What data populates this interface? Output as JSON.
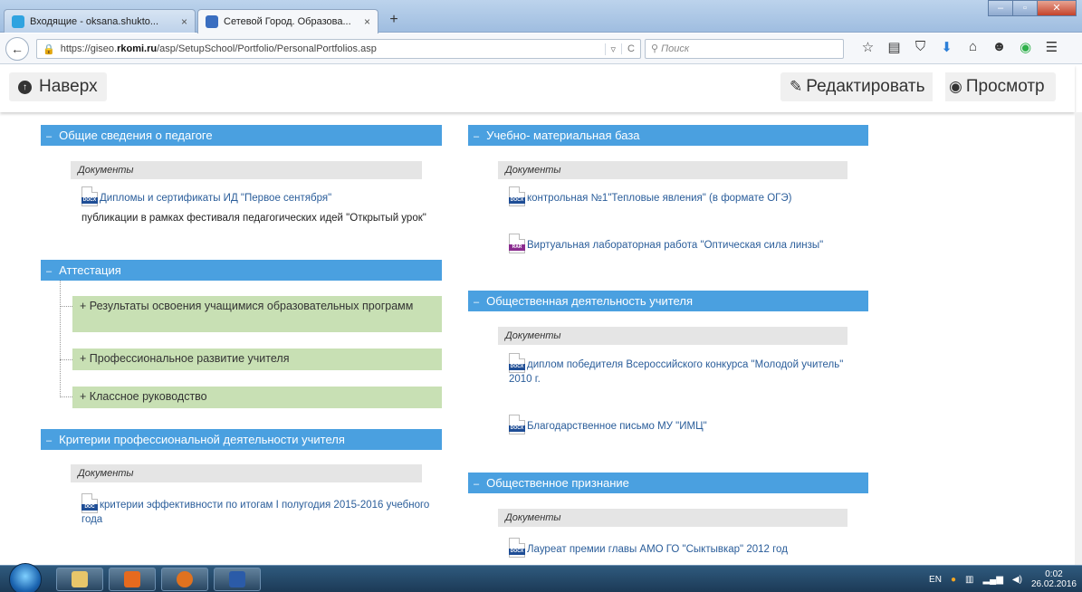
{
  "browser": {
    "tabs": [
      {
        "title": "Входящие - oksana.shukto...",
        "close": "×",
        "favicon_color": "#2fa3e0"
      },
      {
        "title": "Сетевой Город. Образова...",
        "close": "×",
        "favicon_color": "#3a6ec0"
      }
    ],
    "new_tab": "+",
    "window_controls": {
      "minimize": "–",
      "maximize": "▫",
      "close": "✕"
    },
    "url": {
      "prefix": "https://giseo.",
      "domain": "rkomi.ru",
      "path": "/asp/SetupSchool/Portfolio/PersonalPortfolios.asp"
    },
    "url_tools": {
      "dropdown": "▿",
      "reload": "C"
    },
    "search_placeholder": "Поиск",
    "search_icon": "⚲",
    "toolbar_icons": [
      "☆",
      "▤",
      "⛉",
      "⬇",
      "⌂",
      "☻",
      "◉",
      "☰"
    ]
  },
  "page": {
    "up_button": "Наверх",
    "edit_button": "Редактировать",
    "view_button": "Просмотр"
  },
  "left": {
    "general": {
      "toggle": "–",
      "title": "Общие сведения о педагоге",
      "docs_label": "Документы",
      "doc1": {
        "text": "Дипломы и сертификаты ИД \"Первое сентября\"",
        "type": "DOCX"
      },
      "plain_text": "публикации в рамках фестиваля педагогических идей \"Открытый урок\""
    },
    "attestation": {
      "toggle": "–",
      "title": "Аттестация",
      "sub1": {
        "toggle": "+",
        "title": "Результаты освоения учащимися образовательных программ"
      },
      "sub2": {
        "toggle": "+",
        "title": "Профессиональное развитие учителя"
      },
      "sub3": {
        "toggle": "+",
        "title": "Классное руководство"
      }
    },
    "criteria": {
      "toggle": "–",
      "title": "Критерии профессиональной деятельности учителя",
      "docs_label": "Документы",
      "doc1": {
        "text": "критерии эффективности по итогам I полугодия 2015-2016 учебного года",
        "type": "DOC"
      }
    }
  },
  "right": {
    "material": {
      "toggle": "–",
      "title": "Учебно- материальная база",
      "docs_label": "Документы",
      "doc1": {
        "text": "контрольная №1\"Тепловые явления\" (в формате ОГЭ)",
        "type": "DOCX"
      },
      "doc2": {
        "text": "Виртуальная лабораторная работа \"Оптическая сила линзы\"",
        "type": "RAR"
      }
    },
    "social": {
      "toggle": "–",
      "title": "Общественная деятельность учителя",
      "docs_label": "Документы",
      "doc1": {
        "text": "диплом победителя Всероссийского конкурса \"Молодой учитель\" 2010 г.",
        "type": "DOCX"
      },
      "doc2": {
        "text": "Благодарственное письмо МУ \"ИМЦ\"",
        "type": "DOCX"
      }
    },
    "recognition": {
      "toggle": "–",
      "title": "Общественное признание",
      "docs_label": "Документы",
      "doc1": {
        "text": "Лауреат премии главы АМО ГО \"Сыктывкар\" 2012 год",
        "type": "DOCX"
      }
    }
  },
  "taskbar": {
    "lang": "EN",
    "time": "0:02",
    "date": "26.02.2016",
    "apps": [
      {
        "name": "explorer",
        "color": "#e8c66a"
      },
      {
        "name": "media-player",
        "color": "#e66a1e"
      },
      {
        "name": "firefox",
        "color": "#e0721f"
      },
      {
        "name": "word",
        "color": "#2b5ba8"
      }
    ]
  },
  "colors": {
    "section_header": "#4aa0e0",
    "subsection": "#c8e0b4",
    "link": "#2a5d9a",
    "docx_tag": "#1f4e96",
    "doc_tag": "#1f4e96",
    "rar_tag": "#8a2c8f"
  }
}
